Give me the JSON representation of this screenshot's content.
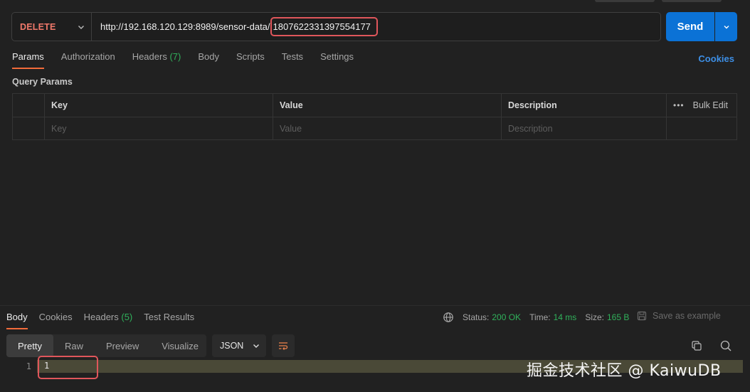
{
  "request": {
    "method": "DELETE",
    "url_base": "http://192.168.120.129:8989/sensor-data/",
    "url_id": "1807622331397554177",
    "send_label": "Send"
  },
  "request_tabs": {
    "params": "Params",
    "authorization": "Authorization",
    "headers": "Headers",
    "headers_count": "(7)",
    "body": "Body",
    "scripts": "Scripts",
    "tests": "Tests",
    "settings": "Settings",
    "cookies": "Cookies"
  },
  "query_params": {
    "title": "Query Params",
    "headers": {
      "key": "Key",
      "value": "Value",
      "description": "Description",
      "bulk_edit": "Bulk Edit"
    },
    "placeholders": {
      "key": "Key",
      "value": "Value",
      "description": "Description"
    }
  },
  "response": {
    "tabs": {
      "body": "Body",
      "cookies": "Cookies",
      "headers": "Headers",
      "headers_count": "(5)",
      "test_results": "Test Results"
    },
    "status_label": "Status:",
    "status_value": "200 OK",
    "time_label": "Time:",
    "time_value": "14 ms",
    "size_label": "Size:",
    "size_value": "165 B",
    "save_example": "Save as example",
    "views": {
      "pretty": "Pretty",
      "raw": "Raw",
      "preview": "Preview",
      "visualize": "Visualize"
    },
    "format": "JSON",
    "line_number": "1",
    "line_content": "1"
  },
  "watermark": "掘金技术社区 @ KaiwuDB",
  "colors": {
    "method": "#f0786a",
    "send": "#0b72d6",
    "accent_tab": "#f26b3a",
    "status_ok": "#30b15b",
    "highlight_box": "#e0565b"
  }
}
